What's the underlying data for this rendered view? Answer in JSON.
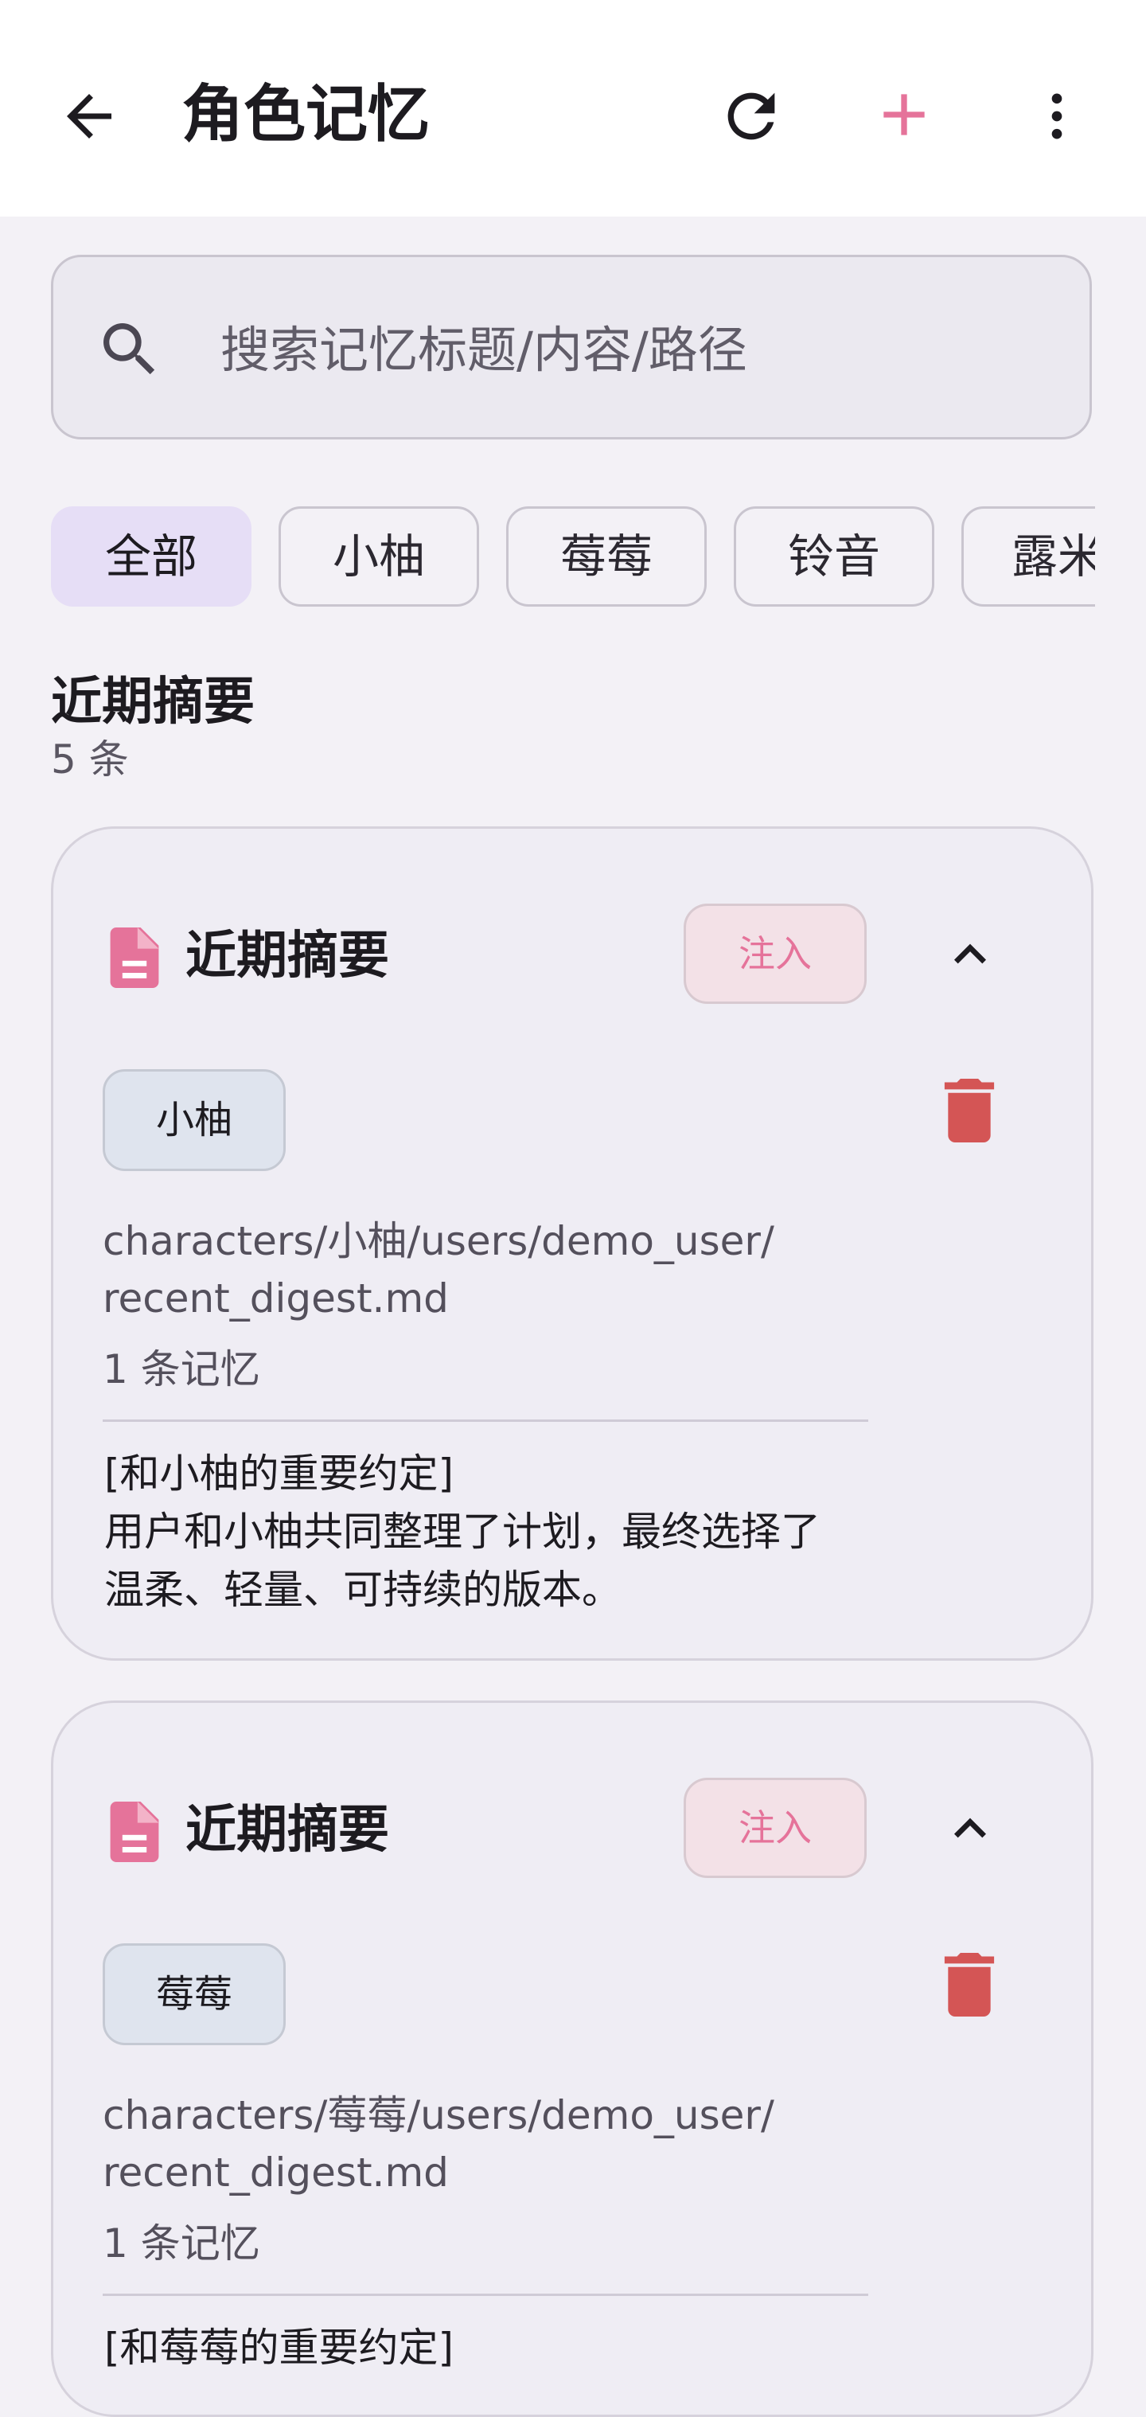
{
  "appbar": {
    "title": "角色记忆",
    "icons": {
      "back": "arrow-back-icon",
      "refresh": "refresh-icon",
      "add": "add-icon",
      "more": "more-vert-icon"
    },
    "accent": "#e5739a"
  },
  "search": {
    "placeholder": "搜索记忆标题/内容/路径",
    "value": ""
  },
  "filters": {
    "chips": [
      {
        "label": "全部",
        "selected": true
      },
      {
        "label": "小柚",
        "selected": false
      },
      {
        "label": "莓莓",
        "selected": false
      },
      {
        "label": "铃音",
        "selected": false
      },
      {
        "label": "露米",
        "selected": false
      }
    ]
  },
  "section": {
    "title": "近期摘要",
    "count": "5 条"
  },
  "cards": [
    {
      "title": "近期摘要",
      "inject_label": "注入",
      "character": "小柚",
      "path": "characters/小柚/users/demo_user/\nrecent_digest.md",
      "memory_count": "1 条记忆",
      "content_title": "[和小柚的重要约定]",
      "content_line1": "用户和小柚共同整理了计划，最终选择了",
      "content_line2": "温柔、轻量、可持续的版本。"
    },
    {
      "title": "近期摘要",
      "inject_label": "注入",
      "character": "莓莓",
      "path": "characters/莓莓/users/demo_user/\nrecent_digest.md",
      "memory_count": "1 条记忆",
      "content_title": "[和莓莓的重要约定]"
    }
  ],
  "colors": {
    "doc_icon": "#e5739a",
    "trash_icon": "#d45555",
    "selected_chip": "#e6def6"
  }
}
